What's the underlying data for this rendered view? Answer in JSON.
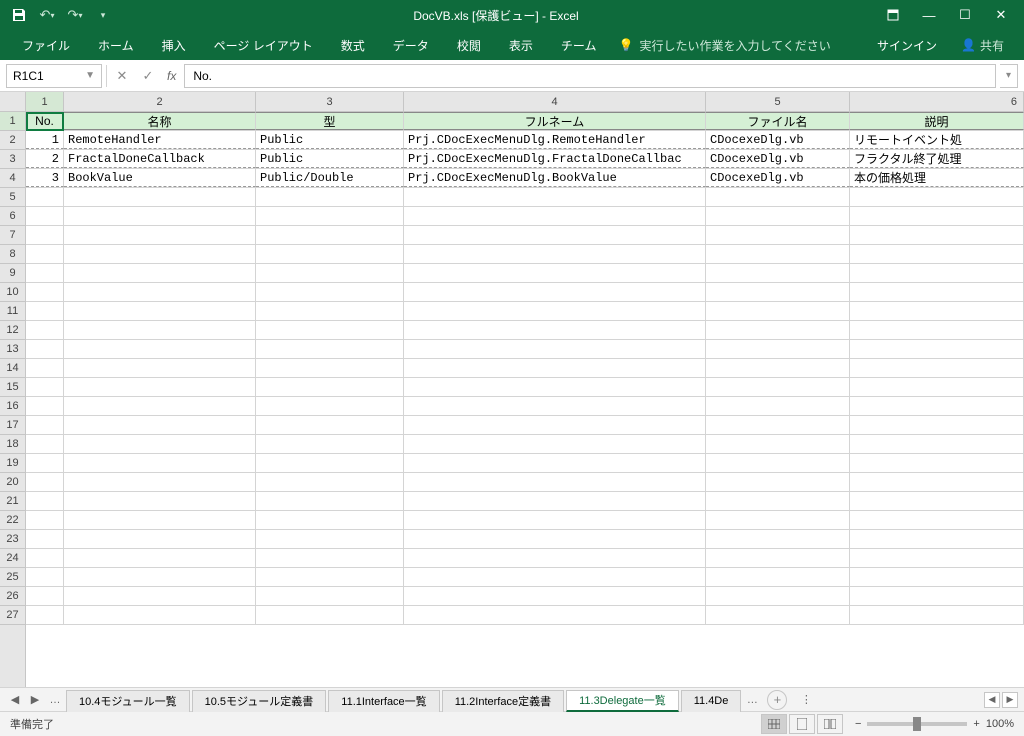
{
  "title": "DocVB.xls  [保護ビュー] - Excel",
  "qat": {
    "save": "💾"
  },
  "ribbon_tabs": [
    "ファイル",
    "ホーム",
    "挿入",
    "ページ レイアウト",
    "数式",
    "データ",
    "校閲",
    "表示",
    "チーム"
  ],
  "tellme": "実行したい作業を入力してください",
  "signin": "サインイン",
  "share": "共有",
  "namebox": "R1C1",
  "formula": "No.",
  "col_headers": [
    "1",
    "2",
    "3",
    "4",
    "5",
    "6"
  ],
  "row_headers": [
    "1",
    "2",
    "3",
    "4",
    "5",
    "6",
    "7",
    "8",
    "9",
    "10",
    "11",
    "12",
    "13",
    "14",
    "15",
    "16",
    "17",
    "18",
    "19",
    "20",
    "21",
    "22",
    "23",
    "24",
    "25",
    "26",
    "27"
  ],
  "table": {
    "headers": [
      "No.",
      "名称",
      "型",
      "フルネーム",
      "ファイル名",
      "説明"
    ],
    "rows": [
      {
        "no": "1",
        "name": "RemoteHandler",
        "type": "Public",
        "full": "Prj.CDocExecMenuDlg.RemoteHandler",
        "file": "CDocexeDlg.vb",
        "desc": "リモートイベント処"
      },
      {
        "no": "2",
        "name": "FractalDoneCallback",
        "type": "Public",
        "full": "Prj.CDocExecMenuDlg.FractalDoneCallbac",
        "file": "CDocexeDlg.vb",
        "desc": "フラクタル終了処理"
      },
      {
        "no": "3",
        "name": "BookValue",
        "type": "Public/Double",
        "full": "Prj.CDocExecMenuDlg.BookValue",
        "file": "CDocexeDlg.vb",
        "desc": "本の価格処理"
      }
    ]
  },
  "sheet_tabs": [
    "10.4モジュール一覧",
    "10.5モジュール定義書",
    "11.1Interface一覧",
    "11.2Interface定義書",
    "11.3Delegate一覧",
    "11.4De"
  ],
  "active_sheet_index": 4,
  "status": "準備完了",
  "zoom": "100%"
}
